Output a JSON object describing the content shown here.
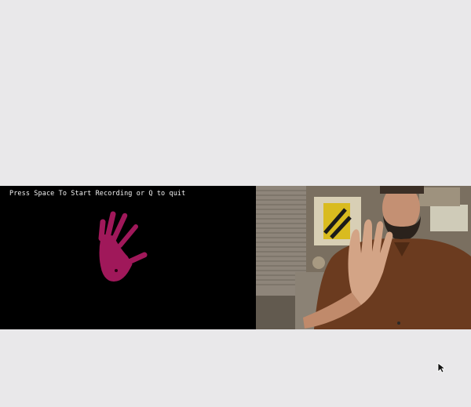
{
  "instruction_text": "Press Space To Start Recording or Q to quit",
  "colors": {
    "background": "#e9e8ea",
    "mask_panel": "#000000",
    "hand_mask": "#a0185a",
    "instruction_text": "#f2f2f2"
  },
  "icons": {
    "cursor": "mouse-pointer-icon"
  }
}
